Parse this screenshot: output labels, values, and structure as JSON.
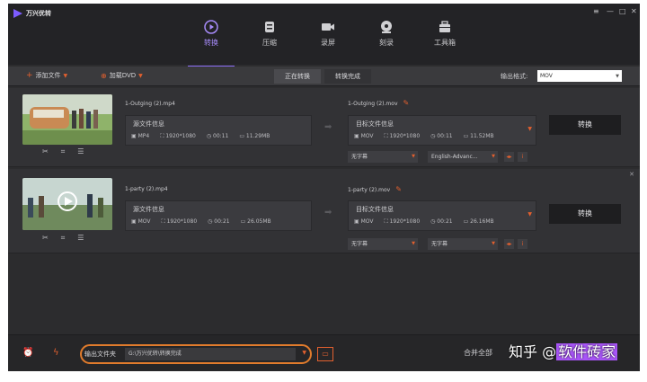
{
  "app": {
    "title": "万兴优转"
  },
  "window_controls": [
    "≡",
    "—",
    "□",
    "✕"
  ],
  "tabs": [
    {
      "label": "转换",
      "icon": "play-circle-icon",
      "active": true
    },
    {
      "label": "压缩",
      "icon": "compress-icon",
      "active": false
    },
    {
      "label": "录屏",
      "icon": "camera-icon",
      "active": false
    },
    {
      "label": "刻录",
      "icon": "disc-icon",
      "active": false
    },
    {
      "label": "工具箱",
      "icon": "toolbox-icon",
      "active": false
    }
  ],
  "toolbar": {
    "add_file": "添加文件",
    "load_dvd": "加载DVD",
    "converting": "正在转换",
    "converted": "转换完成",
    "output_format_label": "输出格式:",
    "output_format_value": "MOV"
  },
  "items": [
    {
      "src_name": "1-Outging (2).mp4",
      "src_info_title": "源文件信息",
      "src_meta": {
        "format": "MP4",
        "resolution": "1920*1080",
        "duration": "00:11",
        "size": "11.29MB"
      },
      "dst_name": "1-Outging (2).mov",
      "dst_info_title": "目标文件信息",
      "dst_meta": {
        "format": "MOV",
        "resolution": "1920*1080",
        "duration": "00:11",
        "size": "11.52MB"
      },
      "subtitle": "无字幕",
      "audio": "English-Advanc...",
      "convert_label": "转换"
    },
    {
      "src_name": "1-party (2).mp4",
      "src_info_title": "源文件信息",
      "src_meta": {
        "format": "MOV",
        "resolution": "1920*1080",
        "duration": "00:21",
        "size": "26.05MB"
      },
      "dst_name": "1-party (2).mov",
      "dst_info_title": "目标文件信息",
      "dst_meta": {
        "format": "MOV",
        "resolution": "1920*1080",
        "duration": "00:21",
        "size": "26.16MB"
      },
      "subtitle": "无字幕",
      "audio": "无字幕",
      "convert_label": "转换"
    }
  ],
  "bottom": {
    "output_folder_label": "输出文件夹",
    "output_path": "G:\\万兴优转\\转换完成",
    "merge_label": "合并全部"
  },
  "watermark": {
    "prefix": "知乎 @",
    "highlight": "软件砖家"
  },
  "colors": {
    "accent": "#8b6cf7",
    "orange": "#e2602f",
    "highlight": "#e07b2c"
  }
}
